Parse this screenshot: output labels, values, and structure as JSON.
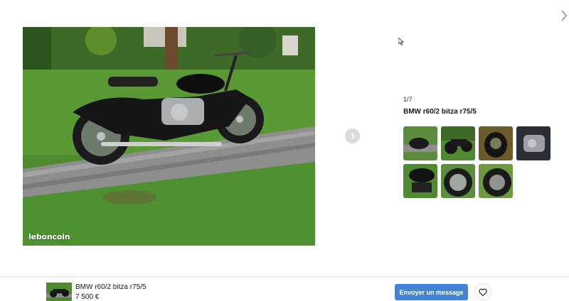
{
  "gallery": {
    "counter": "1/7",
    "title": "BMW r60/2 bitza r75/5",
    "watermark": "leboncoin",
    "thumbnail_count": 7
  },
  "icons": {
    "top_right": "chevron-right-icon",
    "next_photo": "chevron-right-icon",
    "favorite": "heart-icon",
    "cursor": "mouse-pointer-icon"
  },
  "ad_bar": {
    "title": "BMW r60/2 bitza r75/5",
    "price": "7 500 €",
    "message_button": "Envoyer un message"
  },
  "colors": {
    "accent": "#4183d7",
    "next_button_bg": "#d9d9d9"
  }
}
